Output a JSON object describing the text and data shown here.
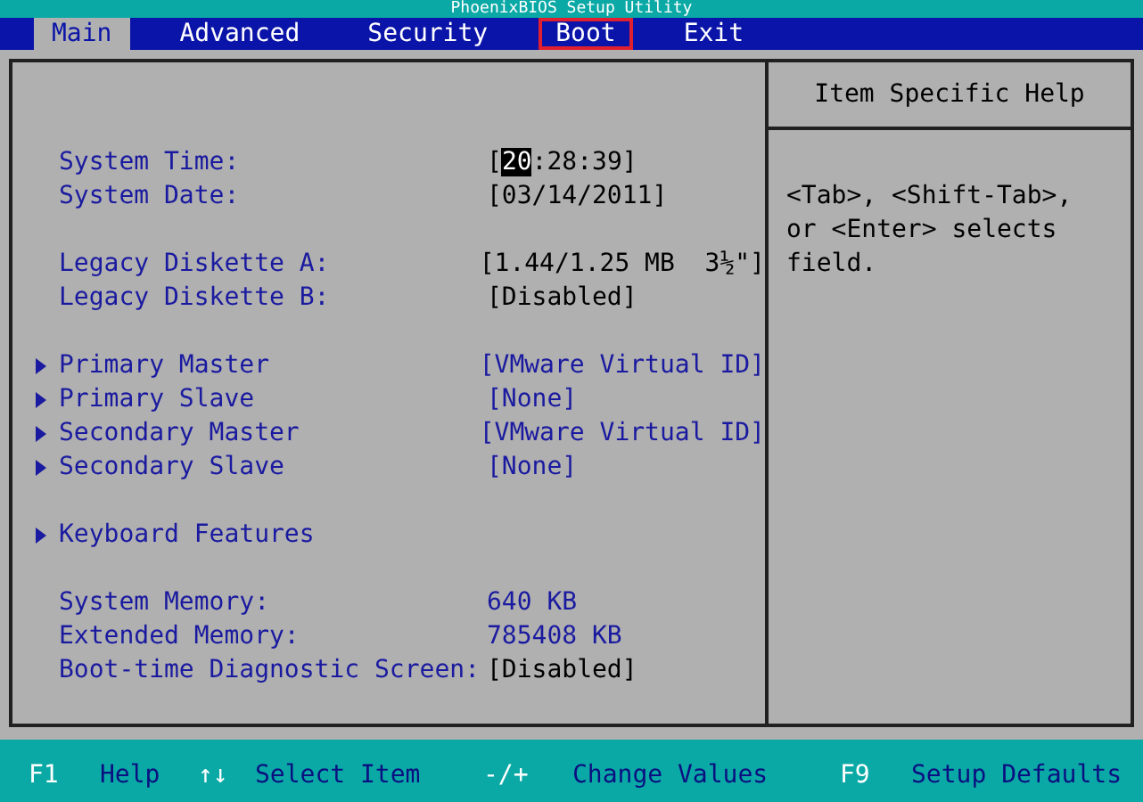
{
  "title": "PhoenixBIOS Setup Utility",
  "tabs": [
    {
      "label": "Main",
      "selected": true,
      "outlined": false
    },
    {
      "label": "Advanced",
      "selected": false,
      "outlined": false
    },
    {
      "label": "Security",
      "selected": false,
      "outlined": false
    },
    {
      "label": "Boot",
      "selected": false,
      "outlined": true
    },
    {
      "label": "Exit",
      "selected": false,
      "outlined": false
    }
  ],
  "rows": [
    {
      "kind": "blank"
    },
    {
      "kind": "field",
      "label": "System Time:",
      "editable": true,
      "value_parts": [
        {
          "text": "[",
          "selected": false
        },
        {
          "text": "20",
          "selected": true
        },
        {
          "text": ":28:39]",
          "selected": false
        }
      ]
    },
    {
      "kind": "field",
      "label": "System Date:",
      "editable": true,
      "value_parts": [
        {
          "text": "[03/14/2011]",
          "selected": false
        }
      ]
    },
    {
      "kind": "blank"
    },
    {
      "kind": "field",
      "label": "Legacy Diskette A:",
      "editable": true,
      "value_parts": [
        {
          "text": "[1.44/1.25 MB  3½\"]",
          "selected": false
        }
      ]
    },
    {
      "kind": "field",
      "label": "Legacy Diskette B:",
      "editable": true,
      "value_parts": [
        {
          "text": "[Disabled]",
          "selected": false
        }
      ]
    },
    {
      "kind": "blank"
    },
    {
      "kind": "submenu",
      "label": "Primary Master",
      "value_parts": [
        {
          "text": "[VMware Virtual ID]",
          "selected": false
        }
      ]
    },
    {
      "kind": "submenu",
      "label": "Primary Slave",
      "value_parts": [
        {
          "text": "[None]",
          "selected": false
        }
      ]
    },
    {
      "kind": "submenu",
      "label": "Secondary Master",
      "value_parts": [
        {
          "text": "[VMware Virtual ID]",
          "selected": false
        }
      ]
    },
    {
      "kind": "submenu",
      "label": "Secondary Slave",
      "value_parts": [
        {
          "text": "[None]",
          "selected": false
        }
      ]
    },
    {
      "kind": "blank"
    },
    {
      "kind": "submenu",
      "label": "Keyboard Features"
    },
    {
      "kind": "blank"
    },
    {
      "kind": "field",
      "label": "System Memory:",
      "editable": false,
      "value_parts": [
        {
          "text": "640 KB",
          "selected": false
        }
      ]
    },
    {
      "kind": "field",
      "label": "Extended Memory:",
      "editable": false,
      "value_parts": [
        {
          "text": "785408 KB",
          "selected": false
        }
      ]
    },
    {
      "kind": "field",
      "label": "Boot-time Diagnostic Screen:",
      "editable": true,
      "value_parts": [
        {
          "text": "[Disabled]",
          "selected": false
        }
      ]
    }
  ],
  "help": {
    "title": "Item Specific Help",
    "text": "<Tab>, <Shift-Tab>, or <Enter> selects field."
  },
  "keys": [
    {
      "key": "F1",
      "action": "Help"
    },
    {
      "key": "↑↓",
      "action": "Select Item"
    },
    {
      "key": "-/+",
      "action": "Change Values"
    },
    {
      "key": "F9",
      "action": "Setup Defaults"
    }
  ]
}
